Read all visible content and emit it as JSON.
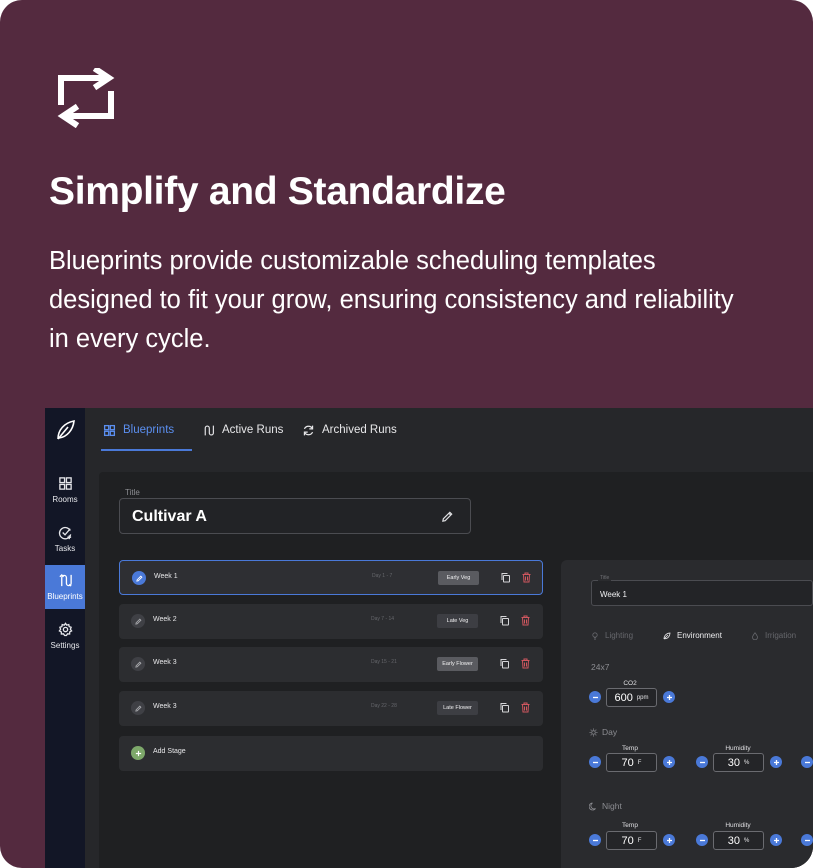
{
  "hero": {
    "title": "Simplify and Standardize",
    "description": "Blueprints provide customizable scheduling templates designed to fit your grow, ensuring consistency and reliability in every cycle."
  },
  "colors": {
    "background": "#542a3f",
    "accent": "#4a79d8",
    "sidebar": "#121626",
    "add": "#7da86a",
    "danger": "#d1575f"
  },
  "sidebar": {
    "items": [
      {
        "label": "Rooms",
        "icon": "grid-icon"
      },
      {
        "label": "Tasks",
        "icon": "check-circle-icon"
      },
      {
        "label": "Blueprints",
        "icon": "route-icon",
        "active": true
      },
      {
        "label": "Settings",
        "icon": "gear-icon"
      }
    ]
  },
  "tabs": [
    {
      "label": "Blueprints",
      "icon": "grid-icon",
      "active": true
    },
    {
      "label": "Active Runs",
      "icon": "route-icon"
    },
    {
      "label": "Archived Runs",
      "icon": "refresh-icon"
    }
  ],
  "blueprint": {
    "title_label": "Title",
    "title": "Cultivar A"
  },
  "stages": [
    {
      "name": "Week 1",
      "days": "Day 1 - 7",
      "badge": "Early Veg",
      "selected": true
    },
    {
      "name": "Week 2",
      "days": "Day 7 - 14",
      "badge": "Late Veg"
    },
    {
      "name": "Week 3",
      "days": "Day 15 - 21",
      "badge": "Early Flower"
    },
    {
      "name": "Week 3",
      "days": "Day 22 - 28",
      "badge": "Late Flower"
    }
  ],
  "add_stage": {
    "label": "Add Stage"
  },
  "panel": {
    "week_label": "Title",
    "week_value": "Week 1",
    "subtabs": [
      "Lighting",
      "Environment",
      "Irrigation"
    ],
    "schedule": "24x7",
    "co2": {
      "label": "CO2",
      "value": "600",
      "unit": "ppm"
    },
    "day": {
      "label": "Day",
      "temp": {
        "label": "Temp",
        "value": "70",
        "unit": "F"
      },
      "humidity": {
        "label": "Humidity",
        "value": "30",
        "unit": "%"
      }
    },
    "night": {
      "label": "Night",
      "temp": {
        "label": "Temp",
        "value": "70",
        "unit": "F"
      },
      "humidity": {
        "label": "Humidity",
        "value": "30",
        "unit": "%"
      }
    }
  }
}
